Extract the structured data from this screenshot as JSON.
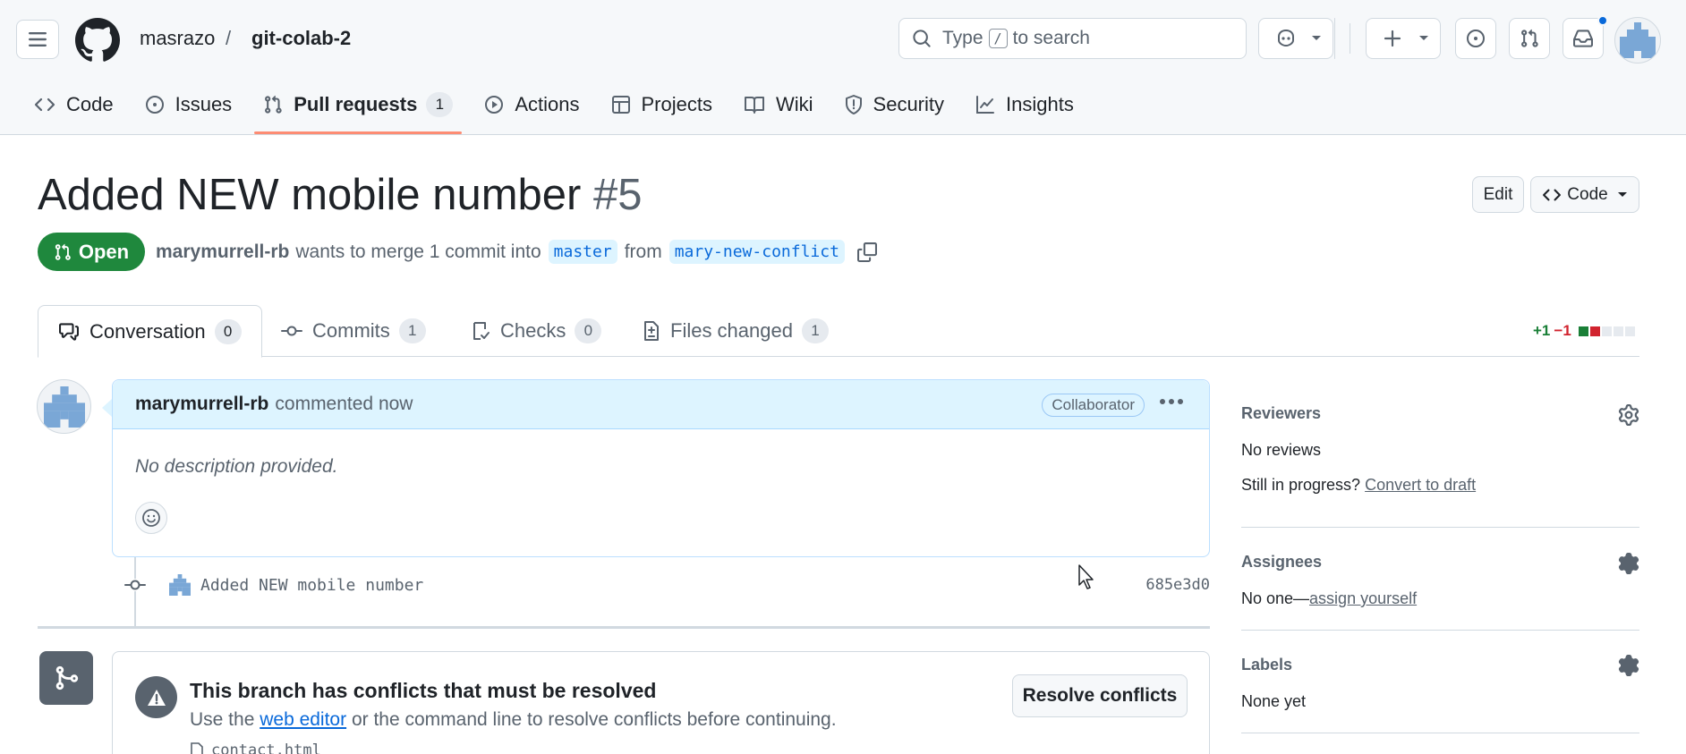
{
  "header": {
    "owner": "masrazo",
    "separator": "/",
    "repo": "git-colab-2",
    "search_prefix": "Type",
    "search_key": "/",
    "search_suffix": "to search",
    "icons": [
      "hamburger-icon",
      "github-logo-icon",
      "search-icon",
      "copilot-icon",
      "plus-icon",
      "issue-icon",
      "pull-request-icon",
      "inbox-icon"
    ]
  },
  "nav": {
    "items": [
      {
        "label": "Code",
        "icon": "code-icon"
      },
      {
        "label": "Issues",
        "icon": "issue-icon"
      },
      {
        "label": "Pull requests",
        "icon": "pull-request-icon",
        "count": "1",
        "active": true
      },
      {
        "label": "Actions",
        "icon": "play-icon"
      },
      {
        "label": "Projects",
        "icon": "table-icon"
      },
      {
        "label": "Wiki",
        "icon": "book-icon"
      },
      {
        "label": "Security",
        "icon": "shield-icon"
      },
      {
        "label": "Insights",
        "icon": "graph-icon"
      }
    ]
  },
  "pr": {
    "title": "Added NEW mobile number",
    "number": "#5",
    "edit_label": "Edit",
    "code_label": "Code",
    "state": "Open",
    "author": "marymurrell-rb",
    "merge_text": "wants to merge 1 commit into",
    "base_branch": "master",
    "from_text": "from",
    "head_branch": "mary-new-conflict"
  },
  "tabs": [
    {
      "label": "Conversation",
      "count": "0",
      "icon": "conversation-icon"
    },
    {
      "label": "Commits",
      "count": "1",
      "icon": "commit-icon"
    },
    {
      "label": "Checks",
      "count": "0",
      "icon": "checklist-icon"
    },
    {
      "label": "Files changed",
      "count": "1",
      "icon": "file-diff-icon"
    }
  ],
  "diffstat": {
    "additions": "+1",
    "deletions": "−1",
    "green": "#1a7f37",
    "red": "#d1242f"
  },
  "comment": {
    "author": "marymurrell-rb",
    "action": "commented now",
    "badge": "Collaborator",
    "body": "No description provided."
  },
  "commit": {
    "message": "Added NEW mobile number",
    "sha": "685e3d0"
  },
  "merge": {
    "title": "This branch has conflicts that must be resolved",
    "sub_prefix": "Use the",
    "sub_link": "web editor",
    "sub_suffix": "or the command line to resolve conflicts before continuing.",
    "button": "Resolve conflicts",
    "file": "contact.html"
  },
  "sidebar": {
    "reviewers": {
      "heading": "Reviewers",
      "value": "No reviews",
      "progress_text": "Still in progress?",
      "progress_link": "Convert to draft"
    },
    "assignees": {
      "heading": "Assignees",
      "value": "No one—",
      "link": "assign yourself"
    },
    "labels": {
      "heading": "Labels",
      "value": "None yet"
    }
  },
  "colors": {
    "accent": "#0969da",
    "open_green": "#1f883d",
    "underline": "#fd8c73"
  }
}
